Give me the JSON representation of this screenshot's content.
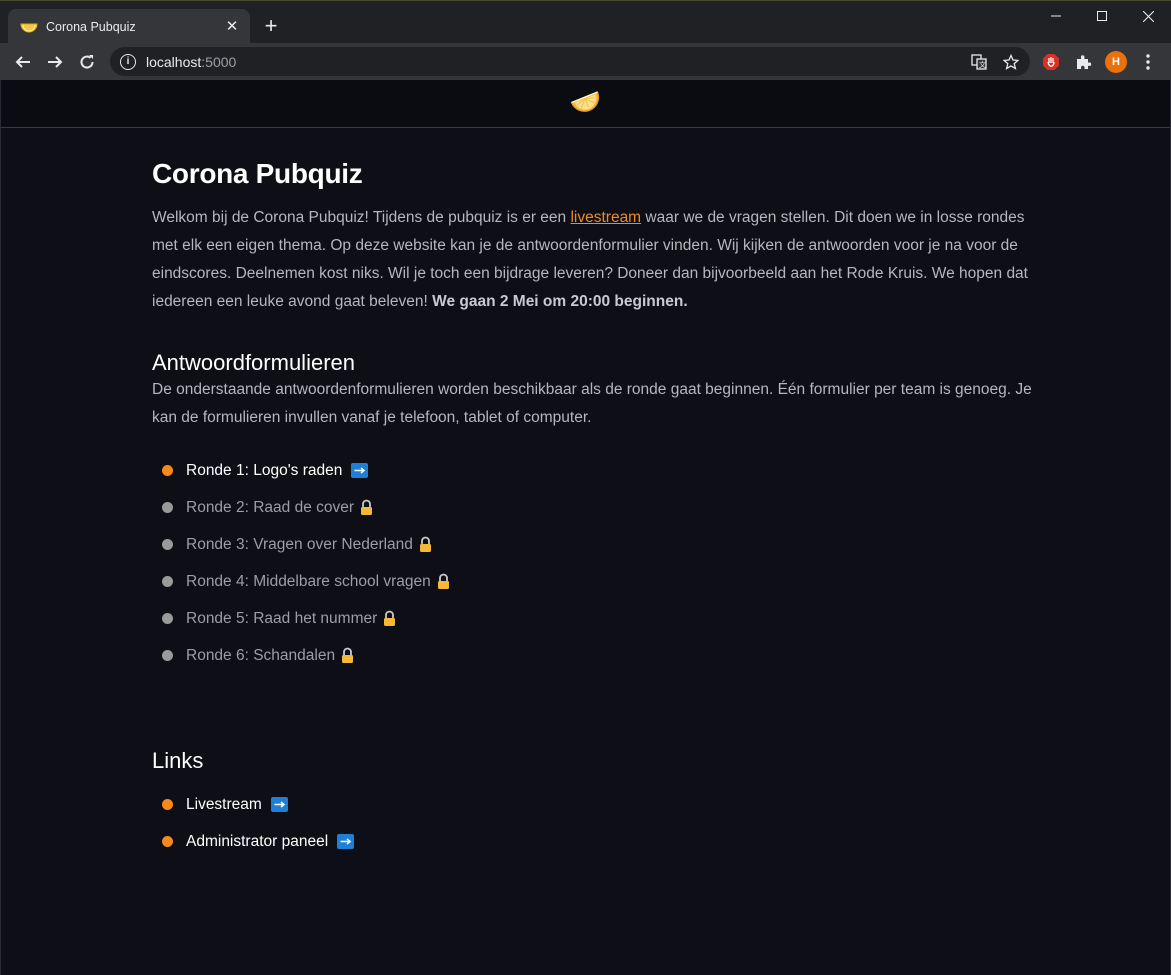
{
  "browser": {
    "tab_title": "Corona Pubquiz",
    "url_host": "localhost",
    "url_port": ":5000",
    "profile_initial": "H"
  },
  "page": {
    "title": "Corona Pubquiz",
    "intro_before_link": "Welkom bij de Corona Pubquiz! Tijdens de pubquiz is er een ",
    "intro_link": "livestream",
    "intro_after_link": " waar we de vragen stellen. Dit doen we in losse rondes met elk een eigen thema. Op deze website kan je de antwoordenformulier vinden. Wij kijken de antwoorden voor je na voor de eindscores. Deelnemen kost niks. Wil je toch een bijdrage leveren? Doneer dan bijvoorbeeld aan het Rode Kruis. We hopen dat iedereen een leuke avond gaat beleven! ",
    "intro_bold": "We gaan 2 Mei om 20:00 beginnen.",
    "forms_title": "Antwoordformulieren",
    "forms_desc": "De onderstaande antwoordenformulieren worden beschikbaar als de ronde gaat beginnen. Één formulier per team is genoeg. Je kan de formulieren invullen vanaf je telefoon, tablet of computer.",
    "rounds": [
      {
        "label": "Ronde 1: Logo's raden",
        "status": "open"
      },
      {
        "label": "Ronde 2: Raad de cover",
        "status": "locked"
      },
      {
        "label": "Ronde 3: Vragen over Nederland",
        "status": "locked"
      },
      {
        "label": "Ronde 4: Middelbare school vragen",
        "status": "locked"
      },
      {
        "label": "Ronde 5: Raad het nummer",
        "status": "locked"
      },
      {
        "label": "Ronde 6: Schandalen",
        "status": "locked"
      }
    ],
    "links_title": "Links",
    "links": [
      {
        "label": "Livestream"
      },
      {
        "label": "Administrator paneel"
      }
    ]
  },
  "colors": {
    "accent": "#f58a1a",
    "arrow": "#1e7fd6",
    "background": "#0e0e16"
  },
  "icons": {
    "logo": "lemon-slice-icon",
    "open_round": "arrow-right-icon",
    "locked_round": "lock-icon"
  }
}
